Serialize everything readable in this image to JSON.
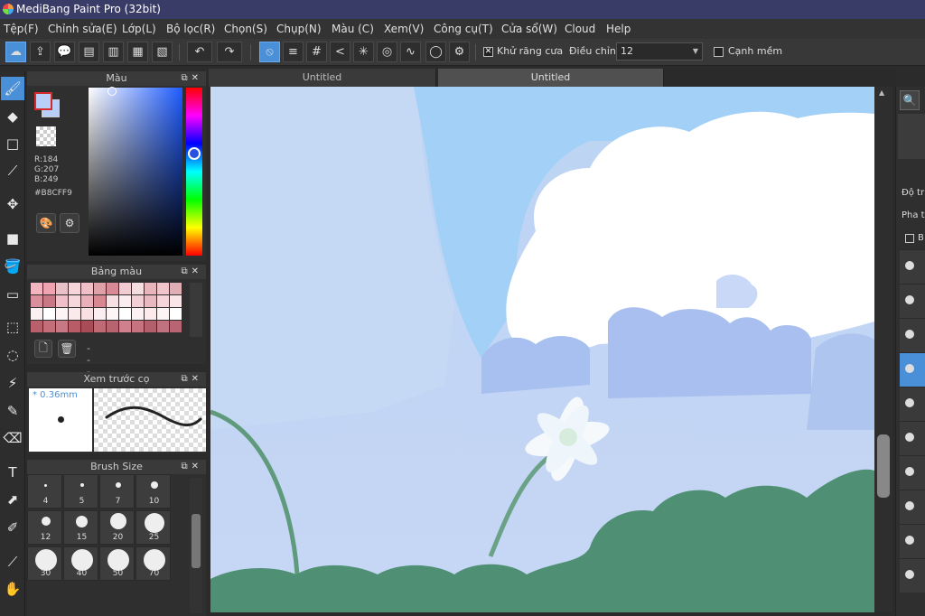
{
  "window": {
    "title": "MediBang Paint Pro (32bit)"
  },
  "menu": [
    "Tệp(F)",
    "Chỉnh sửa(E)",
    "Lớp(L)",
    "Bộ lọc(R)",
    "Chọn(S)",
    "Chụp(N)",
    "Màu (C)",
    "Xem(V)",
    "Công cụ(T)",
    "Cửa sổ(W)",
    "Cloud",
    "Help"
  ],
  "toolbar": {
    "antialias_label": "Khử răng cưa",
    "antialias_checked": "✕",
    "adjust_label": "Điều chỉnh",
    "adjust_value": "12",
    "soft_edge_label": "Cạnh mềm"
  },
  "tabs": [
    "Untitled",
    "Untitled"
  ],
  "color_panel": {
    "title": "Màu",
    "r": "R:184",
    "g": "G:207",
    "b": "B:249",
    "hex": "#B8CFF9",
    "current_color": "#B8CFF9"
  },
  "palette_panel": {
    "title": "Bảng màu",
    "name": "---",
    "colors": [
      "#f3b5bf",
      "#f0a3b0",
      "#e8c2c8",
      "#f5d5da",
      "#f0c0c8",
      "#e0a0a8",
      "#d88a96",
      "#f2ccd2",
      "#f5dde0",
      "#e8b5bd",
      "#f0c6cc",
      "#e0aeb5",
      "#d9909c",
      "#c97886",
      "#f0c0c8",
      "#f5d8dc",
      "#e8b0b8",
      "#d88890",
      "#f5e0e3",
      "#fbeef0",
      "#f2d0d5",
      "#e8bac0",
      "#f5d5d9",
      "#fae6e8",
      "#fbf1f2",
      "#ffffff",
      "#fdf4f5",
      "#fbeaec",
      "#f8e0e3",
      "#fbeef0",
      "#fdf6f7",
      "#ffffff",
      "#fdf2f3",
      "#fcebed",
      "#fdf4f5",
      "#ffffff",
      "#b8606c",
      "#c46e7a",
      "#c87884",
      "#b85c68",
      "#a84c58",
      "#c06a76",
      "#b86470",
      "#d0808c",
      "#c87480",
      "#b4606c",
      "#c07280",
      "#b86472"
    ]
  },
  "preview_panel": {
    "title": "Xem trước cọ",
    "size": "* 0.36mm"
  },
  "size_panel": {
    "title": "Brush Size",
    "sizes": [
      "4",
      "5",
      "7",
      "10",
      "12",
      "15",
      "20",
      "25",
      "30",
      "40",
      "50",
      "70"
    ]
  },
  "right_panel": {
    "opacity_label": "Độ tr",
    "blend_label": "Pha t",
    "check_label": "B"
  },
  "icons": {
    "tools": [
      "brush-icon",
      "eraser-icon",
      "rectangle-shape-icon",
      "dot-brush-icon",
      "move-icon",
      "fill-rect-icon",
      "bucket-icon",
      "gradient-icon",
      "select-rect-icon",
      "lasso-icon",
      "magic-wand-icon",
      "select-pen-icon",
      "select-eraser-icon",
      "text-icon",
      "operation-icon",
      "eyedropper-icon",
      "dropper-icon",
      "hand-icon"
    ]
  },
  "accent": "#4a90d9"
}
